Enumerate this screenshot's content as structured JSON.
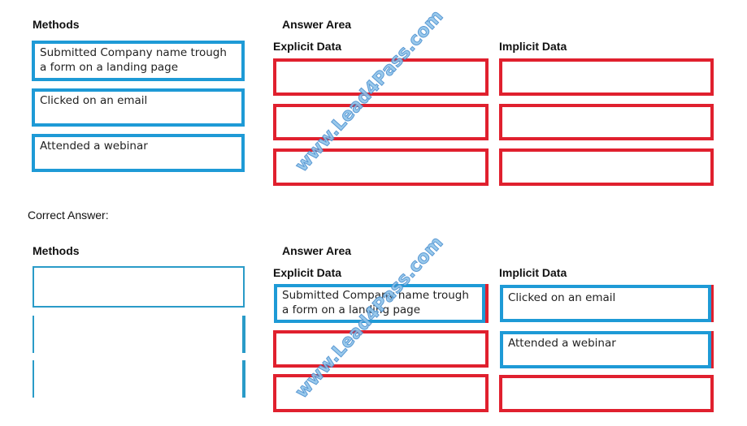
{
  "question": {
    "methods_header": "Methods",
    "answer_area_header": "Answer Area",
    "explicit_header": "Explicit Data",
    "implicit_header": "Implicit Data",
    "methods": [
      "Submitted Company name trough a form on a landing page",
      "Clicked on an email",
      "Attended a webinar"
    ],
    "explicit_slots": [
      "",
      "",
      ""
    ],
    "implicit_slots": [
      "",
      "",
      ""
    ]
  },
  "correct_answer_label": "Correct Answer:",
  "answer": {
    "methods_header": "Methods",
    "answer_area_header": "Answer Area",
    "explicit_header": "Explicit Data",
    "implicit_header": "Implicit Data",
    "methods": [
      "",
      "",
      ""
    ],
    "explicit_slots": [
      "Submitted Company name trough a form on a landing page",
      "",
      ""
    ],
    "implicit_slots": [
      "Clicked on an email",
      "Attended a webinar",
      ""
    ]
  },
  "watermark": "www.Lead4Pass.com",
  "colors": {
    "method_border": "#1e9ad6",
    "slot_border": "#e0202e",
    "watermark": "#8ec4ea"
  }
}
